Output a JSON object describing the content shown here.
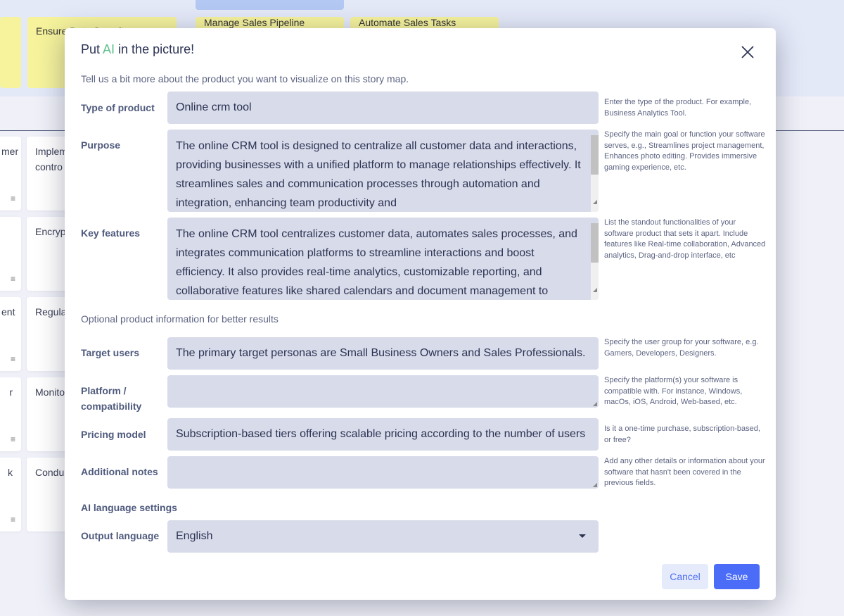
{
  "background": {
    "stickies": [
      "",
      "Ensure Data Security",
      "Manage Sales Pipeline",
      "Automate Sales Tasks"
    ],
    "cards_col1": [
      "mer",
      "",
      "ent",
      "r",
      "k"
    ],
    "cards_col2": [
      "Implem\ncontro",
      "Encryp",
      "Regula",
      "Monito",
      "Condu"
    ]
  },
  "modal": {
    "title_prefix": "Put ",
    "title_accent": "AI",
    "title_suffix": " in the picture!",
    "accent_color": "#5cc08a",
    "intro": "Tell us a bit more about the product you want to visualize on this story map.",
    "fields": {
      "type": {
        "label": "Type of product",
        "value": "Online crm tool",
        "help": "Enter the type of the product. For example, Business Analytics Tool."
      },
      "purpose": {
        "label": "Purpose",
        "value": "The online CRM tool is designed to centralize all customer data and interactions, providing businesses with a unified platform to manage relationships effectively. It streamlines sales and communication processes through automation and integration, enhancing team productivity and",
        "help": "Specify the main goal or function your software serves, e.g., Streamlines project management, Enhances photo editing. Provides immersive gaming experience, etc."
      },
      "features": {
        "label": "Key features",
        "value": "The online CRM tool centralizes customer data, automates sales processes, and integrates communication platforms to streamline interactions and boost efficiency. It also provides real-time analytics, customizable reporting, and collaborative features like shared calendars and document management to",
        "help": "List the standout functionalities of your software product that sets it apart. Include features like Real-time collaboration, Advanced analytics, Drag-and-drop interface, etc"
      },
      "optional_heading": "Optional product information for better results",
      "users": {
        "label": "Target users",
        "value": "The primary target personas are Small Business Owners and Sales Professionals.",
        "help": "Specify the user group for your software, e.g. Gamers, Developers, Designers."
      },
      "platform": {
        "label_line1": "Platform /",
        "label_line2": "compatibility",
        "value": "",
        "help": "Specify the platform(s) your software is compatible with. For instance, Windows, macOs, iOS, Android, Web-based, etc."
      },
      "pricing": {
        "label": "Pricing model",
        "value": "Subscription-based tiers offering scalable pricing according to the number of users",
        "help": "Is it a one-time purchase, subscription-based, or free?"
      },
      "notes": {
        "label": "Additional notes",
        "value": "",
        "help": "Add any other details or information about your software that hasn't been covered in the previous fields."
      },
      "lang_heading": "AI language settings",
      "language": {
        "label": "Output language",
        "value": "English"
      }
    },
    "cancel": "Cancel",
    "save": "Save"
  }
}
